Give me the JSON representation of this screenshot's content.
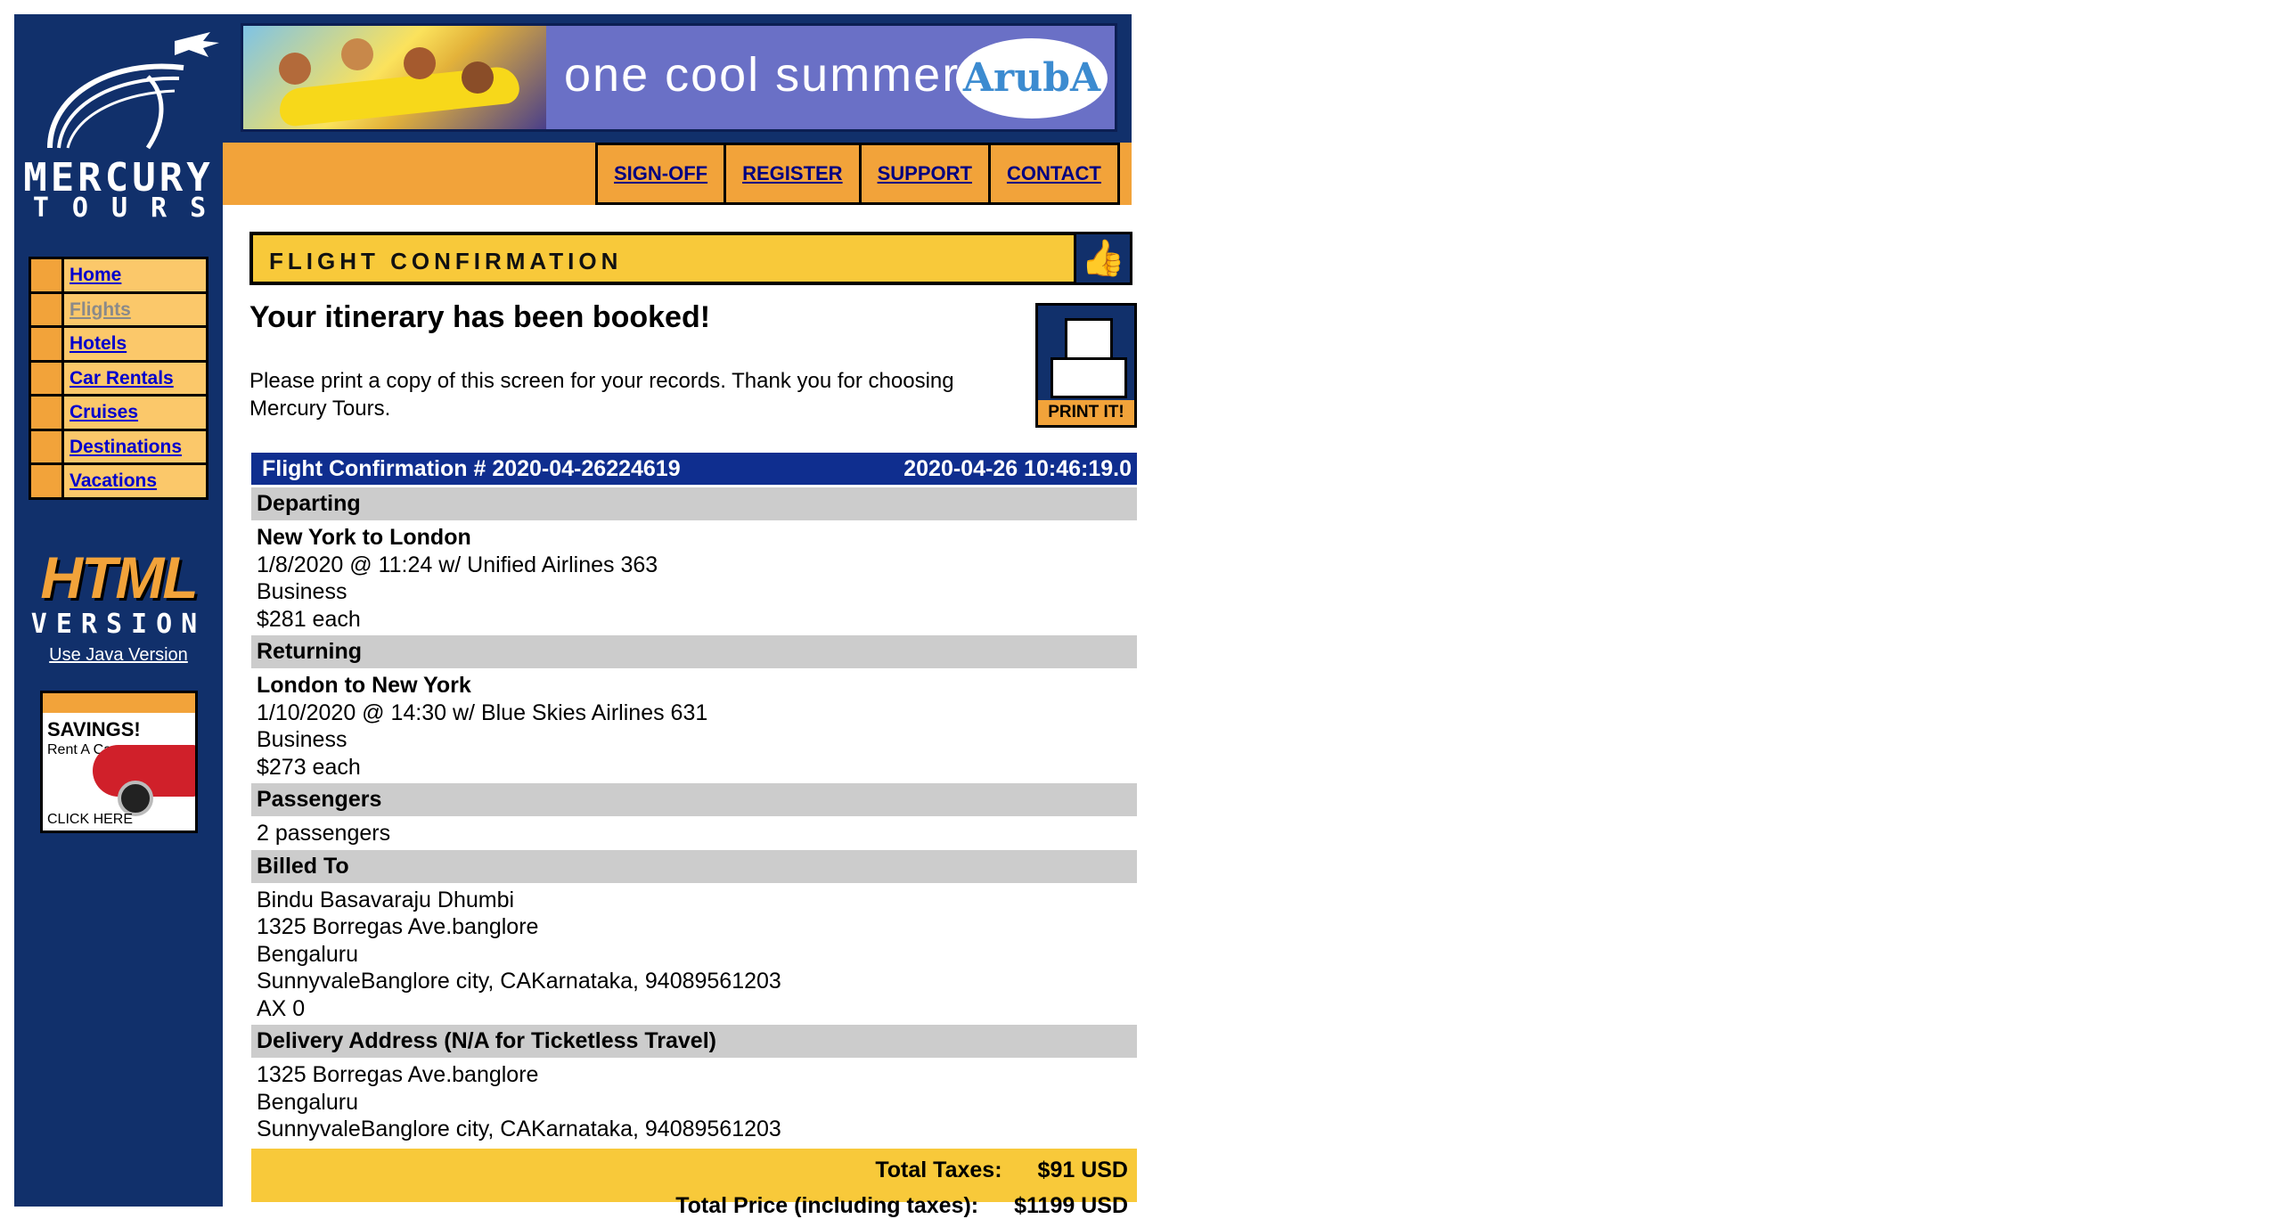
{
  "brand": {
    "name": "MERCURY",
    "sub": "TOURS"
  },
  "banner": {
    "tagline": "one cool summer",
    "logo_text": "ArubA"
  },
  "top_nav": [
    "SIGN-OFF",
    "REGISTER",
    "SUPPORT",
    "CONTACT"
  ],
  "left_menu": [
    {
      "label": "Home",
      "active": true
    },
    {
      "label": "Flights",
      "active": false
    },
    {
      "label": "Hotels",
      "active": true
    },
    {
      "label": "Car Rentals",
      "active": true
    },
    {
      "label": "Cruises",
      "active": true
    },
    {
      "label": "Destinations",
      "active": true
    },
    {
      "label": "Vacations",
      "active": true
    }
  ],
  "html_version": {
    "line1": "HTML",
    "line2": "VERSION",
    "link": "Use Java Version"
  },
  "savings_ad": {
    "title": "SAVINGS!",
    "subtitle": "Rent A Car",
    "cta": "CLICK HERE"
  },
  "confirmation_header": "FLIGHT CONFIRMATION",
  "booked_title": "Your itinerary has been booked!",
  "print_message": "Please print a copy of this screen for your records. Thank you for choosing Mercury Tours.",
  "print_button": "PRINT IT!",
  "itinerary": {
    "confirmation_label": "Flight Confirmation # 2020-04-26224619",
    "timestamp": "2020-04-26 10:46:19.0",
    "departing": {
      "heading": "Departing",
      "route": "New York to London",
      "flight": "1/8/2020 @ 11:24 w/ Unified Airlines 363",
      "class": "Business",
      "price": "$281 each"
    },
    "returning": {
      "heading": "Returning",
      "route": "London to New York",
      "flight": "1/10/2020 @ 14:30 w/ Blue Skies Airlines 631",
      "class": "Business",
      "price": "$273 each"
    },
    "passengers": {
      "heading": "Passengers",
      "value": "2 passengers"
    },
    "billed_to": {
      "heading": "Billed To",
      "name": "Bindu Basavaraju Dhumbi",
      "address": "1325 Borregas Ave.banglore",
      "city": "Bengaluru",
      "state_line": "SunnyvaleBanglore city, CAKarnataka, 94089561203",
      "card": "AX 0"
    },
    "delivery": {
      "heading": "Delivery Address (N/A for Ticketless Travel)",
      "address": "1325 Borregas Ave.banglore",
      "city": "Bengaluru",
      "state_line": "SunnyvaleBanglore city, CAKarnataka, 94089561203"
    },
    "totals": {
      "taxes_label": "Total Taxes:",
      "taxes_value": "$91 USD",
      "price_label": "Total Price (including taxes):",
      "price_value": "$1199 USD"
    }
  },
  "colors": {
    "navy": "#11306b",
    "orange": "#f2a33a",
    "yellow": "#f8c93a",
    "blue_header": "#0f2e8f",
    "gray": "#cccccc"
  }
}
